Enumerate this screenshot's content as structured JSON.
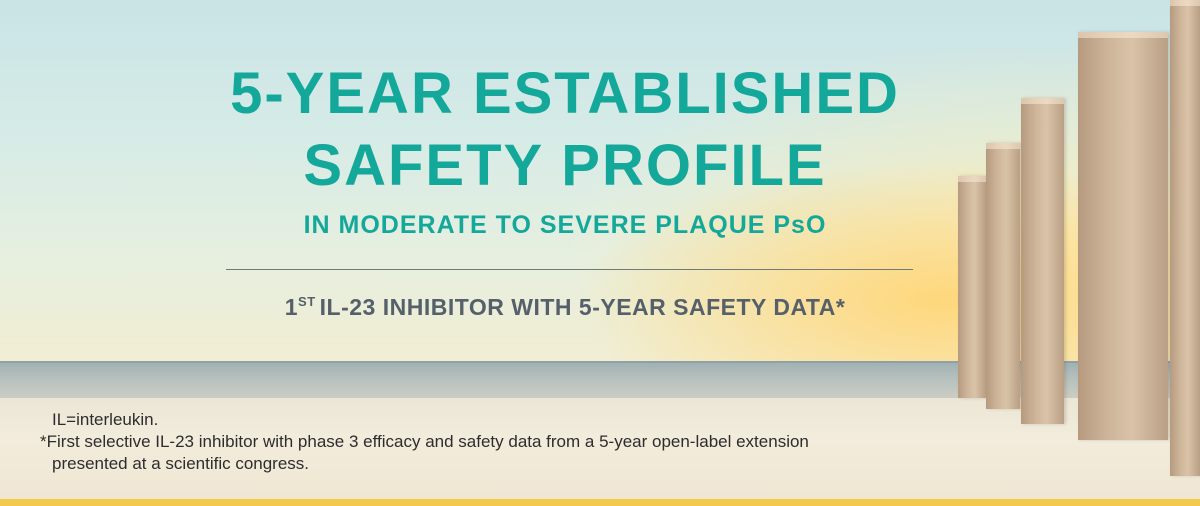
{
  "banner": {
    "headline_line1": "5-YEAR ESTABLISHED",
    "headline_line2": "SAFETY PROFILE",
    "subheading": "IN MODERATE TO SEVERE PLAQUE PsO",
    "tagline_number": "1",
    "tagline_superscript": "ST",
    "tagline_text": "IL-23 INHIBITOR WITH 5-YEAR SAFETY DATA*"
  },
  "footnotes": {
    "abbreviation": "IL=interleukin.",
    "asterisk_line1": "*First selective IL-23 inhibitor with phase 3 efficacy and safety data from a 5-year open-label extension",
    "asterisk_line2": "presented at a scientific congress."
  },
  "colors": {
    "headline": "#14a89a",
    "tagline": "#55606a",
    "accent_bar": "#f2c94c"
  }
}
